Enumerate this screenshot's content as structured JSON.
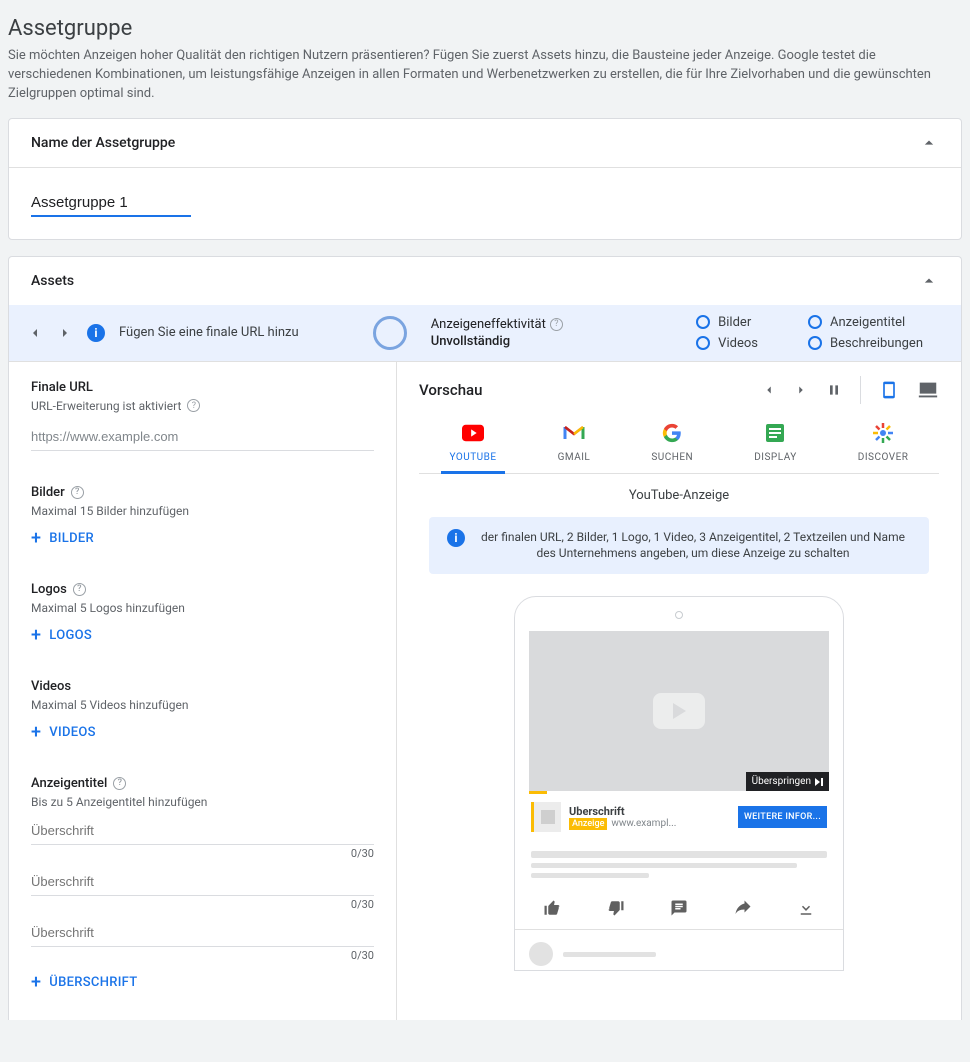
{
  "page": {
    "title": "Assetgruppe",
    "description": "Sie möchten Anzeigen hoher Qualität den richtigen Nutzern präsentieren? Fügen Sie zuerst Assets hinzu, die Bausteine jeder Anzeige. Google testet die verschiedenen Kombinationen, um leistungsfähige Anzeigen in allen Formaten und Werbenetzwerken zu erstellen, die für Ihre Zielvorhaben und die gewünschten Zielgruppen optimal sind."
  },
  "nameCard": {
    "title": "Name der Assetgruppe",
    "value": "Assetgruppe 1"
  },
  "assetsCard": {
    "title": "Assets",
    "bar": {
      "hint": "Fügen Sie eine finale URL hinzu",
      "strengthLabel": "Anzeigeneffektivität",
      "strengthValue": "Unvollständig",
      "checks": {
        "images": "Bilder",
        "headlines": "Anzeigentitel",
        "videos": "Videos",
        "descriptions": "Beschreibungen"
      }
    }
  },
  "left": {
    "finalUrl": {
      "label": "Finale URL",
      "sub": "URL-Erweiterung ist aktiviert",
      "value": "https://www.example.com"
    },
    "images": {
      "label": "Bilder",
      "sub": "Maximal 15 Bilder hinzufügen",
      "button": "BILDER"
    },
    "logos": {
      "label": "Logos",
      "sub": "Maximal 5 Logos hinzufügen",
      "button": "LOGOS"
    },
    "videos": {
      "label": "Videos",
      "sub": "Maximal 5 Videos hinzufügen",
      "button": "VIDEOS"
    },
    "headlines": {
      "label": "Anzeigentitel",
      "sub": "Bis zu 5 Anzeigentitel hinzufügen",
      "placeholder": "Überschrift",
      "counter": "0/30",
      "button": "ÜBERSCHRIFT"
    }
  },
  "preview": {
    "title": "Vorschau",
    "tabs": {
      "youtube": "YOUTUBE",
      "gmail": "GMAIL",
      "search": "SUCHEN",
      "display": "DISPLAY",
      "discover": "DISCOVER"
    },
    "subtitle": "YouTube-Anzeige",
    "banner": "der finalen URL, 2 Bilder, 1 Logo, 1 Video, 3 Anzeigentitel, 2 Textzeilen und Name des Unternehmens angeben, um diese Anzeige zu schalten",
    "mock": {
      "skip": "Überspringen",
      "headline": "Uberschrift",
      "badge": "Anzeige",
      "url": "www.exampl...",
      "cta": "WEITERE INFOR..."
    }
  }
}
